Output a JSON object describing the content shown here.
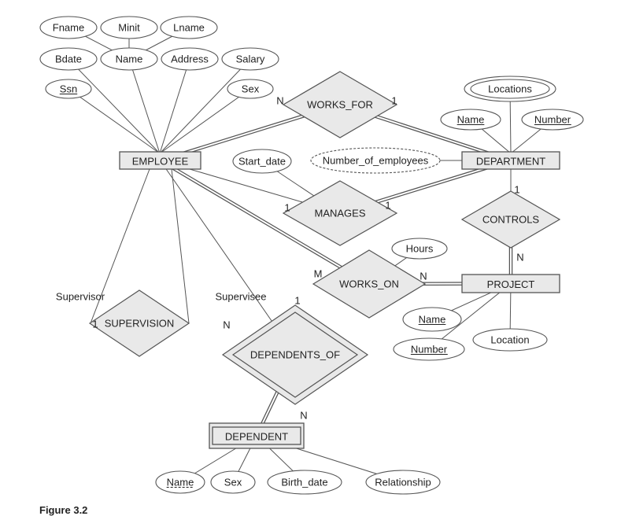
{
  "diagram": {
    "caption": "Figure 3.2",
    "colors": {
      "shape_fill": "#e9e9e9",
      "stroke": "#555555",
      "text": "#222222"
    },
    "entities": [
      {
        "id": "employee",
        "label": "EMPLOYEE",
        "weak": false
      },
      {
        "id": "department",
        "label": "DEPARTMENT",
        "weak": false
      },
      {
        "id": "project",
        "label": "PROJECT",
        "weak": false
      },
      {
        "id": "dependent",
        "label": "DEPENDENT",
        "weak": true
      }
    ],
    "relationships": [
      {
        "id": "works_for",
        "label": "WORKS_FOR",
        "identifying": false
      },
      {
        "id": "manages",
        "label": "MANAGES",
        "identifying": false
      },
      {
        "id": "works_on",
        "label": "WORKS_ON",
        "identifying": false
      },
      {
        "id": "controls",
        "label": "CONTROLS",
        "identifying": false
      },
      {
        "id": "supervision",
        "label": "SUPERVISION",
        "identifying": false
      },
      {
        "id": "dependents_of",
        "label": "DEPENDENTS_OF",
        "identifying": true
      }
    ],
    "attributes": [
      {
        "id": "emp_fname",
        "label": "Fname",
        "owner": "emp_name"
      },
      {
        "id": "emp_minit",
        "label": "Minit",
        "owner": "emp_name"
      },
      {
        "id": "emp_lname",
        "label": "Lname",
        "owner": "emp_name"
      },
      {
        "id": "emp_bdate",
        "label": "Bdate",
        "owner": "employee"
      },
      {
        "id": "emp_name",
        "label": "Name",
        "owner": "employee",
        "composite": true
      },
      {
        "id": "emp_address",
        "label": "Address",
        "owner": "employee"
      },
      {
        "id": "emp_salary",
        "label": "Salary",
        "owner": "employee"
      },
      {
        "id": "emp_ssn",
        "label": "Ssn",
        "owner": "employee",
        "key": "full"
      },
      {
        "id": "emp_sex",
        "label": "Sex",
        "owner": "employee"
      },
      {
        "id": "mgr_start_date",
        "label": "Start_date",
        "owner": "manages"
      },
      {
        "id": "dept_num_employees",
        "label": "Number_of_employees",
        "owner": "department",
        "derived": true
      },
      {
        "id": "dept_locations",
        "label": "Locations",
        "owner": "department",
        "multivalued": true
      },
      {
        "id": "dept_name",
        "label": "Name",
        "owner": "department",
        "key": "full"
      },
      {
        "id": "dept_number",
        "label": "Number",
        "owner": "department",
        "key": "full"
      },
      {
        "id": "wo_hours",
        "label": "Hours",
        "owner": "works_on"
      },
      {
        "id": "proj_name",
        "label": "Name",
        "owner": "project",
        "key": "full"
      },
      {
        "id": "proj_number",
        "label": "Number",
        "owner": "project",
        "key": "full"
      },
      {
        "id": "proj_location",
        "label": "Location",
        "owner": "project"
      },
      {
        "id": "dep_name",
        "label": "Name",
        "owner": "dependent",
        "key": "partial"
      },
      {
        "id": "dep_sex",
        "label": "Sex",
        "owner": "dependent"
      },
      {
        "id": "dep_birth_date",
        "label": "Birth_date",
        "owner": "dependent"
      },
      {
        "id": "dep_relationship",
        "label": "Relationship",
        "owner": "dependent"
      }
    ],
    "links": [
      {
        "from": "employee",
        "to": "works_for",
        "total": true,
        "cardinality": "N"
      },
      {
        "from": "works_for",
        "to": "department",
        "total": true,
        "cardinality": "1"
      },
      {
        "from": "employee",
        "to": "manages",
        "total": false,
        "cardinality": "1"
      },
      {
        "from": "manages",
        "to": "department",
        "total": true,
        "cardinality": "1"
      },
      {
        "from": "employee",
        "to": "works_on",
        "total": true,
        "cardinality": "M"
      },
      {
        "from": "works_on",
        "to": "project",
        "total": true,
        "cardinality": "N"
      },
      {
        "from": "department",
        "to": "controls",
        "total": false,
        "cardinality": "1"
      },
      {
        "from": "controls",
        "to": "project",
        "total": true,
        "cardinality": "N"
      },
      {
        "from": "employee",
        "to": "supervision",
        "total": false,
        "cardinality": "1",
        "role": "Supervisor"
      },
      {
        "from": "employee",
        "to": "supervision",
        "total": false,
        "cardinality": "N",
        "role": "Supervisee"
      },
      {
        "from": "employee",
        "to": "dependents_of",
        "total": false,
        "cardinality": "1"
      },
      {
        "from": "dependents_of",
        "to": "dependent",
        "total": true,
        "cardinality": "N"
      }
    ]
  }
}
